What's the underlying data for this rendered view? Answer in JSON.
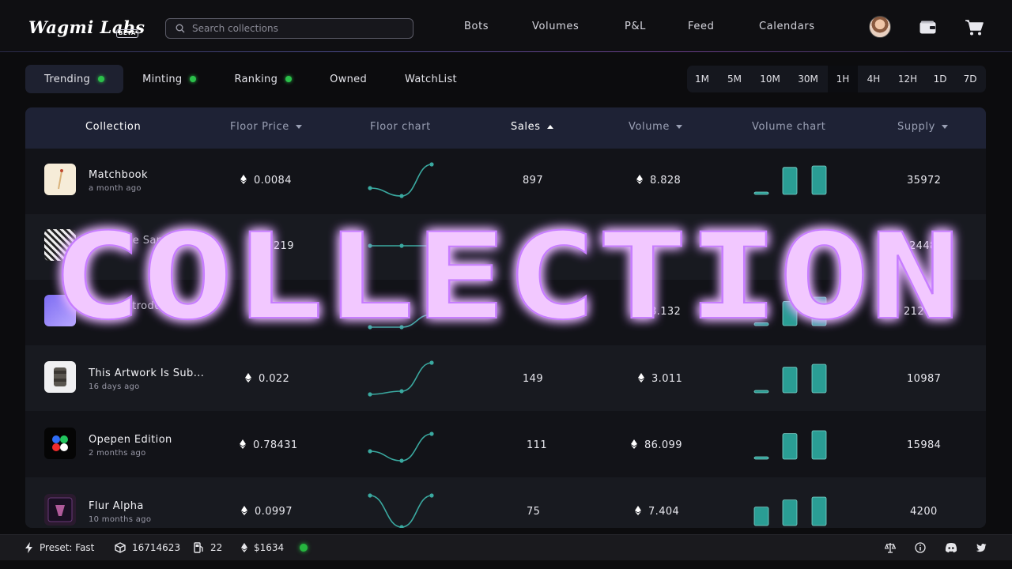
{
  "header": {
    "logo": "Wagmi Labs",
    "badge": "BETA",
    "search_placeholder": "Search collections",
    "nav": [
      "Bots",
      "Volumes",
      "P&L",
      "Feed",
      "Calendars"
    ]
  },
  "filters": {
    "tabs": [
      {
        "label": "Trending",
        "live": true,
        "active": true
      },
      {
        "label": "Minting",
        "live": true
      },
      {
        "label": "Ranking",
        "live": true
      },
      {
        "label": "Owned"
      },
      {
        "label": "WatchList"
      }
    ],
    "periods": [
      "1M",
      "5M",
      "10M",
      "30M",
      "1H",
      "4H",
      "12H",
      "1D",
      "7D"
    ],
    "selected_period": "1H"
  },
  "table": {
    "columns": [
      "Collection",
      "Floor Price",
      "Floor chart",
      "Sales",
      "Volume",
      "Volume chart",
      "Supply"
    ],
    "sort_column": "Sales",
    "rows": [
      {
        "name": "Matchbook",
        "age": "a month ago",
        "floor": "0.0084",
        "sales": "897",
        "volume": "8.828",
        "supply": "35972",
        "floor_chart": [
          0.25,
          0.0,
          1.0
        ],
        "volume_chart": [
          0.05,
          0.95,
          1.0
        ]
      },
      {
        "name": "The Rope Samurai",
        "age": "",
        "floor": "0.0219",
        "sales": "",
        "volume": "",
        "supply": "2448",
        "floor_chart": [
          0.5,
          0.5,
          0.5
        ],
        "volume_chart": []
      },
      {
        "name": "Base, Introduced",
        "age": "",
        "floor": "",
        "sales": "",
        "volume": "8.132",
        "supply": "212450",
        "floor_chart": [
          0.0,
          0.0,
          0.4
        ],
        "volume_chart": [
          0.1,
          0.85,
          1.0
        ]
      },
      {
        "name": "This Artwork Is Sub...",
        "age": "16 days ago",
        "floor": "0.022",
        "sales": "149",
        "volume": "3.011",
        "supply": "10987",
        "floor_chart": [
          0.0,
          0.1,
          1.0
        ],
        "volume_chart": [
          0.05,
          0.9,
          1.0
        ]
      },
      {
        "name": "Opepen Edition",
        "age": "2 months ago",
        "floor": "0.78431",
        "sales": "111",
        "volume": "86.099",
        "supply": "15984",
        "floor_chart": [
          0.3,
          0.0,
          0.85
        ],
        "volume_chart": [
          0.05,
          0.9,
          1.0
        ]
      },
      {
        "name": "Flur Alpha",
        "age": "10 months ago",
        "floor": "0.0997",
        "sales": "75",
        "volume": "7.404",
        "supply": "4200",
        "floor_chart": [
          1.0,
          0.0,
          1.0
        ],
        "volume_chart": [
          0.65,
          0.9,
          1.0
        ]
      }
    ]
  },
  "overlay": {
    "text": "COLLECTION"
  },
  "footer": {
    "preset": "Preset: Fast",
    "block": "16714623",
    "gas": "22",
    "eth_price": "$1634"
  },
  "colors": {
    "accent": "#2bc04a",
    "chart": "#3aa9a0",
    "header_bg": "#1e2235",
    "overlay": "#f2c8ff"
  },
  "icons": [
    "search-icon",
    "wallet-icon",
    "cart-icon",
    "ethereum-icon",
    "lightning-icon",
    "cube-icon",
    "gas-pump-icon",
    "scale-icon",
    "info-icon",
    "discord-icon",
    "twitter-icon"
  ]
}
